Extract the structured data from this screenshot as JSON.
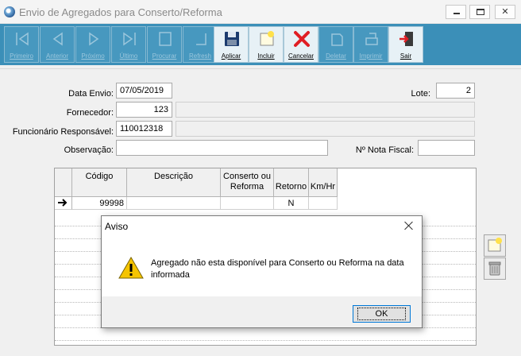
{
  "window": {
    "title": "Envio de Agregados para Conserto/Reforma",
    "app_icon": "globe-icon",
    "controls": [
      "minimize-icon",
      "maximize-icon",
      "close-icon"
    ]
  },
  "toolbar": {
    "buttons": [
      {
        "label": "Primeiro",
        "icon": "first-record-icon",
        "enabled": false
      },
      {
        "label": "Anterior",
        "icon": "previous-record-icon",
        "enabled": false
      },
      {
        "label": "Próximo",
        "icon": "next-record-icon",
        "enabled": false
      },
      {
        "label": "Último",
        "icon": "last-record-icon",
        "enabled": false
      },
      {
        "label": "Procurar",
        "icon": "search-icon",
        "enabled": false
      },
      {
        "label": "Refresh",
        "icon": "refresh-icon",
        "enabled": false
      },
      {
        "label": "Aplicar",
        "icon": "save-disk-icon",
        "enabled": true
      },
      {
        "label": "Incluir",
        "icon": "new-document-icon",
        "enabled": true
      },
      {
        "label": "Cancelar",
        "icon": "red-x-icon",
        "enabled": true
      },
      {
        "label": "Deletar",
        "icon": "delete-icon",
        "enabled": false
      },
      {
        "label": "Imprimir",
        "icon": "print-icon",
        "enabled": false
      },
      {
        "label": "Sair",
        "icon": "exit-door-icon",
        "enabled": true
      }
    ]
  },
  "form": {
    "data_envio": {
      "label": "Data Envio:",
      "value": "07/05/2019"
    },
    "lote": {
      "label": "Lote:",
      "value": "2"
    },
    "fornecedor": {
      "label": "Fornecedor:",
      "value": "123",
      "name": ""
    },
    "funcionario": {
      "label": "Funcionário Responsável:",
      "value": "110012318",
      "name": ""
    },
    "observacao": {
      "label": "Observação:",
      "value": ""
    },
    "nota_fiscal": {
      "label": "Nº Nota Fiscal:",
      "value": ""
    }
  },
  "grid": {
    "columns": [
      {
        "line1": "Código",
        "line2": ""
      },
      {
        "line1": "Descrição",
        "line2": ""
      },
      {
        "line1": "Conserto ou",
        "line2": "Reforma"
      },
      {
        "line1": "",
        "line2": "Retorno"
      },
      {
        "line1": "",
        "line2": "Km/Hr"
      }
    ],
    "rows": [
      {
        "indicator": "arrow-right-icon",
        "codigo": "99998",
        "descricao": "",
        "conserto": "",
        "retorno": "N",
        "km": ""
      }
    ]
  },
  "side_buttons": [
    "add-item-icon",
    "trash-icon"
  ],
  "dialog": {
    "title": "Aviso",
    "icon": "warning-icon",
    "message": "Agregado não esta disponível para Conserto ou Reforma na data informada",
    "ok_label": "OK"
  },
  "colors": {
    "toolbar_bg": "#3b8fb8",
    "disabled_label": "#9ac6dc",
    "cancel_red": "#e01e24"
  }
}
